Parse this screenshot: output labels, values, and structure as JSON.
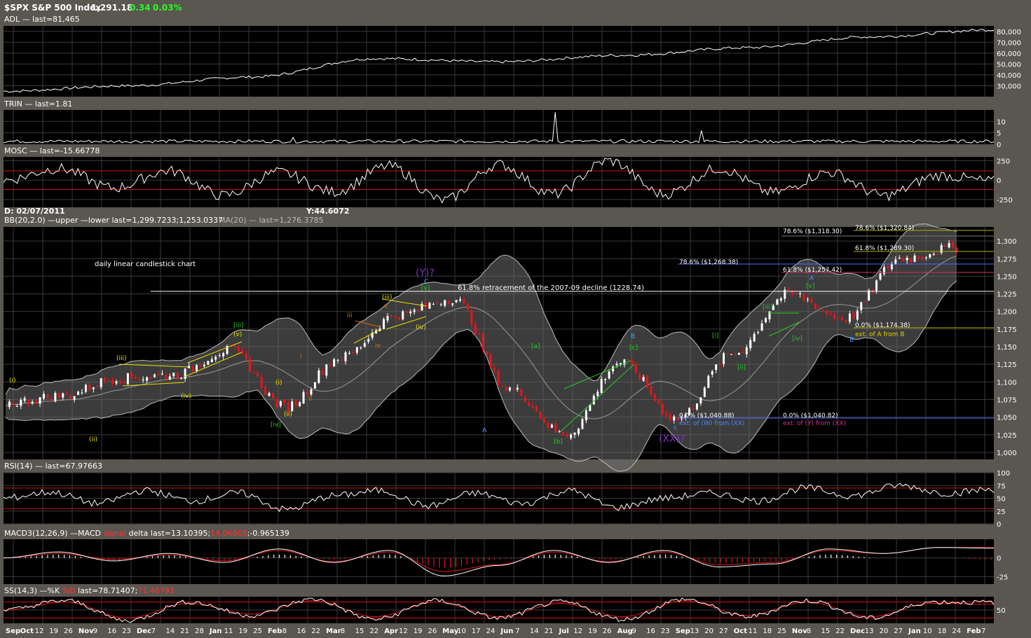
{
  "header": {
    "symbol": "$SPX S&P 500 Index",
    "last": "1,291.18",
    "change": "0.34",
    "change_pct": "0.03%"
  },
  "colors": {
    "background": "#5a5650",
    "panel": "#000000",
    "grid": "#3a3a3a",
    "up_candle": "#ffffff",
    "down_candle": "#e8141a",
    "positive_change": "#22ff22",
    "ref_line": "#d01010",
    "band_fill": "#6e6e6e"
  },
  "date_info": {
    "date_label": "D: 02/07/2011",
    "y_label": "Y:44.6072"
  },
  "x_axis": {
    "labels": [
      "Sep",
      "Oct",
      "12",
      "19",
      "26",
      "Nov",
      "9",
      "16",
      "23",
      "Dec",
      "7",
      "14",
      "21",
      "28",
      "Jan",
      "11",
      "19",
      "25",
      "Feb",
      "8",
      "16",
      "22",
      "Mar",
      "8",
      "15",
      "22",
      "Apr",
      "12",
      "19",
      "26",
      "May",
      "10",
      "17",
      "24",
      "Jun",
      "7",
      "14",
      "21",
      "Jul",
      "12",
      "19",
      "26",
      "Aug",
      "9",
      "16",
      "23",
      "Sep",
      "13",
      "20",
      "27",
      "Oct",
      "11",
      "18",
      "25",
      "Nov",
      "8",
      "15",
      "22",
      "Dec",
      "13",
      "20",
      "27",
      "Jan",
      "10",
      "18",
      "24",
      "Feb",
      "7"
    ]
  },
  "annotations": {
    "chart_type": "daily linear candlestick chart",
    "retracement": "61.8% retracement of the 2007-09 decline (1228.74)",
    "fib": {
      "f1": "78.6%  ($1,318.30)",
      "f2": "78.6%  ($1,320.84)",
      "f3": "61.8%  ($1,289.30)",
      "f4": "78.6%  ($1,268.38)",
      "f5": "61.8%  ($1,257.42)",
      "f6": "0.0%  ($1,174.38)",
      "f7": "ext. of A from B",
      "f8": "0.0%  ($1,040.88)",
      "f9": "ext. of (W) from (XX)",
      "f10": "0.0%  ($1,040.82)",
      "f11": "ext. of (Y) from (XX)"
    },
    "waves": {
      "Y": "(Y)?",
      "XX": "(XX)?",
      "C": "C",
      "A1": "A",
      "A2": "A",
      "B1": "B",
      "B2": "B",
      "c": "c",
      "i1": "(i)",
      "ii1": "(ii)",
      "iii1": "(iii)",
      "iv1": "(iv)",
      "v1": "(v)",
      "iii_g1": "[iii]",
      "iv_g1": "[iv]",
      "i2": "(i)",
      "ii2": "(ii)",
      "i3": "i",
      "ii3": "ii",
      "iii3": "iii",
      "iv3": "iv",
      "v3": "v",
      "iii4": "(iii)",
      "iv4": "(iv)",
      "v_g1": "[v]",
      "b_g1": "[b]",
      "a_g1": "[a]",
      "c_g1": "[c]",
      "i_g2": "[i]",
      "ii_g2": "[ii]",
      "iii_g2": "[iii]",
      "iv_g2": "[iv]",
      "v_g2": "[v]"
    }
  },
  "panels": {
    "adl": {
      "label": "ADL — last=81,465",
      "ticks": [
        "80,000",
        "70,000",
        "60,000",
        "50,000",
        "40,000",
        "30,000"
      ]
    },
    "trin": {
      "label": "TRIN — last=1.81",
      "ticks": [
        "10",
        "5",
        "0"
      ]
    },
    "mosc": {
      "label": "MOSC — last=-15.66778",
      "ticks": [
        "250",
        "0",
        "-250"
      ]
    },
    "price": {
      "bb_label": "BB(20,2.0) —upper —lower last=1,299.7233;1,253.0337",
      "ma_label": "MA(20) — last=1,276.3785",
      "ticks": [
        "1,300",
        "1,275",
        "1,250",
        "1,225",
        "1,200",
        "1,175",
        "1,150",
        "1,125",
        "1,100",
        "1,075",
        "1,050",
        "1,025",
        "1,000"
      ]
    },
    "rsi": {
      "label": "RSI(14) — last=67.97663",
      "ticks": [
        "100",
        "75",
        "50",
        "25",
        "0"
      ]
    },
    "macd": {
      "label_a": "MACD3(12,26,9) —MACD ",
      "label_b": "signal",
      "label_c": " delta last=13.10395;",
      "label_d": "14.06908",
      "label_e": ";-0.965139",
      "ticks": [
        "0",
        "-25"
      ]
    },
    "ss": {
      "label_a": "SS(14,3) —%K ",
      "label_b": "%D",
      "label_c": " last=78.71407;",
      "label_d": "71.46791",
      "ticks": [
        "50"
      ]
    }
  },
  "chart_data": [
    {
      "type": "line",
      "title": "ADL",
      "x": [
        "Sep",
        "Dec",
        "Feb",
        "Apr",
        "Jun",
        "Aug",
        "Oct",
        "Dec",
        "Feb"
      ],
      "series": [
        {
          "name": "ADL",
          "values": [
            25000,
            30000,
            38000,
            55000,
            52000,
            58000,
            65000,
            75000,
            81465
          ]
        }
      ],
      "ylim": [
        20000,
        85000
      ]
    },
    {
      "type": "line",
      "title": "TRIN",
      "series": [
        {
          "name": "TRIN",
          "values": [
            1.0,
            1.2,
            0.9,
            14.0,
            1.1,
            6.0,
            1.0,
            1.81
          ]
        }
      ],
      "ylim": [
        0,
        15
      ]
    },
    {
      "type": "line",
      "title": "MOSC",
      "series": [
        {
          "name": "MOSC",
          "values": [
            0,
            120,
            -150,
            80,
            -260,
            250,
            -180,
            60,
            -15.67
          ]
        }
      ],
      "ylim": [
        -350,
        300
      ]
    },
    {
      "type": "line",
      "title": "$SPX S&P 500 Index",
      "x": [
        "Sep",
        "Oct",
        "Nov",
        "Dec",
        "Jan",
        "Feb",
        "Mar",
        "Apr",
        "May",
        "Jun",
        "Jul",
        "Aug",
        "Sep",
        "Oct",
        "Nov",
        "Dec",
        "Jan",
        "Feb"
      ],
      "series": [
        {
          "name": "close",
          "values": [
            1070,
            1080,
            1105,
            1110,
            1145,
            1065,
            1135,
            1195,
            1218,
            1090,
            1025,
            1128,
            1048,
            1140,
            1225,
            1190,
            1275,
            1291
          ]
        }
      ],
      "ylim": [
        990,
        1320
      ]
    },
    {
      "type": "line",
      "title": "RSI(14)",
      "series": [
        {
          "name": "RSI",
          "values": [
            50,
            62,
            40,
            60,
            28,
            65,
            32,
            60,
            75,
            67.98
          ]
        }
      ],
      "ylim": [
        0,
        100
      ]
    },
    {
      "type": "line",
      "title": "MACD3(12,26,9)",
      "series": [
        {
          "name": "MACD",
          "values": [
            0,
            8,
            -4,
            6,
            -6,
            12,
            -24,
            10,
            -12,
            14,
            13.1
          ]
        },
        {
          "name": "signal",
          "values": [
            0,
            6,
            -2,
            4,
            -4,
            10,
            -18,
            8,
            -9,
            14,
            14.07
          ]
        }
      ],
      "ylim": [
        -35,
        25
      ]
    },
    {
      "type": "line",
      "title": "SS(14,3)",
      "series": [
        {
          "name": "%K",
          "values": [
            50,
            85,
            10,
            80,
            15,
            90,
            20,
            80,
            78.71
          ]
        },
        {
          "name": "%D",
          "values": [
            50,
            80,
            20,
            75,
            25,
            85,
            25,
            75,
            71.47
          ]
        }
      ],
      "ylim": [
        0,
        100
      ]
    }
  ]
}
